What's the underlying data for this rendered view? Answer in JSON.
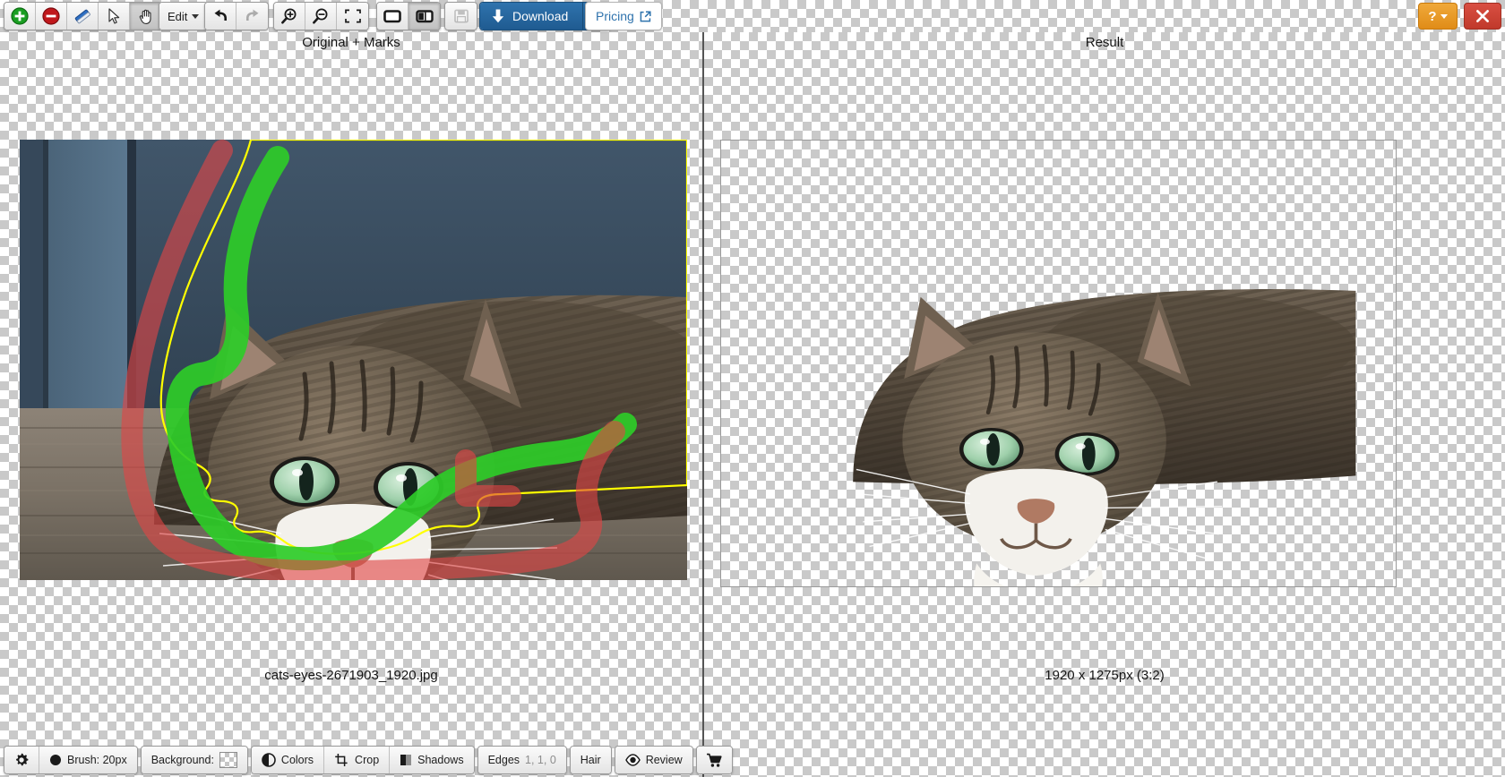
{
  "window": {
    "help_label": "?",
    "close_label": "✕"
  },
  "toolbar": {
    "tools": [
      {
        "name": "add-marker-tool",
        "icon": "plus-circle-icon",
        "title": "Add",
        "active": false
      },
      {
        "name": "remove-marker-tool",
        "icon": "minus-circle-icon",
        "title": "Remove",
        "active": false
      },
      {
        "name": "eraser-tool",
        "icon": "eraser-icon",
        "title": "Eraser",
        "active": false
      },
      {
        "name": "select-tool",
        "icon": "cursor-arrow-icon",
        "title": "Select",
        "active": false
      },
      {
        "name": "pan-tool",
        "icon": "hand-icon",
        "title": "Pan",
        "active": true
      }
    ],
    "edit_label": "Edit",
    "undo_label": "Undo",
    "redo_label": "Redo",
    "undo_enabled": true,
    "redo_enabled": false,
    "zoom_in_label": "Zoom In",
    "zoom_out_label": "Zoom Out",
    "fit_label": "Fit to Screen",
    "view_single_label": "Single View",
    "view_split_label": "Split View",
    "view_split_active": true,
    "save_label": "Save",
    "save_enabled": false,
    "download_label": "Download",
    "pricing_label": "Pricing"
  },
  "panels": {
    "left": {
      "title": "Original + Marks",
      "caption": "cats-eyes-2671903_1920.jpg"
    },
    "right": {
      "title": "Result",
      "caption": "1920 x 1275px (3:2)"
    }
  },
  "bottom_toolbar": {
    "settings_label": "Settings",
    "brush_label": "Brush: 20px",
    "background_label": "Background:",
    "background_value": "transparent",
    "colors_label": "Colors",
    "crop_label": "Crop",
    "shadows_label": "Shadows",
    "edges_label": "Edges",
    "edges_value": "1, 1, 0",
    "hair_label": "Hair",
    "review_label": "Review",
    "cart_label": "Cart"
  },
  "marks": {
    "foreground_color": "#2ecc28",
    "background_color": "#e04545",
    "outline_color": "#ffff00"
  }
}
